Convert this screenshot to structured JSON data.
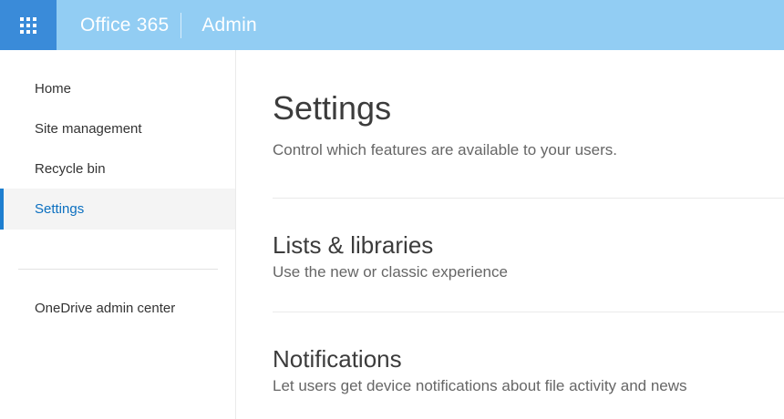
{
  "header": {
    "brand": "Office 365",
    "section": "Admin",
    "colors": {
      "bar_bg": "#92cdf3",
      "launcher_bg": "#3a8bd9",
      "text": "#ffffff"
    }
  },
  "sidebar": {
    "items": [
      {
        "label": "Home",
        "selected": false
      },
      {
        "label": "Site management",
        "selected": false
      },
      {
        "label": "Recycle bin",
        "selected": false
      },
      {
        "label": "Settings",
        "selected": true
      }
    ],
    "secondary_items": [
      {
        "label": "OneDrive admin center"
      }
    ],
    "colors": {
      "selected_bg": "#f4f4f4",
      "selected_text": "#0b6fc0",
      "selected_border": "#1e7fd0",
      "text": "#333333"
    }
  },
  "main": {
    "title": "Settings",
    "subtitle": "Control which features are available to your users.",
    "sections": [
      {
        "heading": "Lists & libraries",
        "description": "Use the new or classic experience"
      },
      {
        "heading": "Notifications",
        "description": "Let users get device notifications about file activity and news"
      }
    ]
  }
}
